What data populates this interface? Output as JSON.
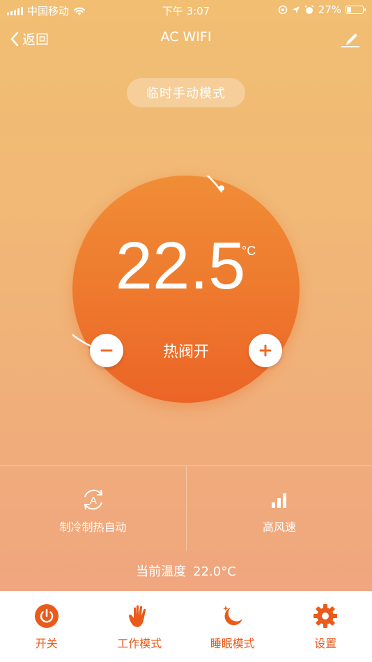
{
  "status_bar": {
    "carrier": "中国移动",
    "time": "下午 3:07",
    "battery_text": "27%",
    "battery_level": 0.27
  },
  "nav": {
    "back_label": "返回",
    "title": "AC WIFI"
  },
  "mode_pill": "临时手动模式",
  "thermostat": {
    "temperature": "22.5",
    "unit": "°C",
    "valve_status": "热阀开"
  },
  "info": {
    "mode_label": "制冷制热自动",
    "fan_label": "高风速"
  },
  "current_temp": {
    "label": "当前温度",
    "value": "22.0°C"
  },
  "tabs": [
    {
      "label": "开关",
      "icon": "power-icon"
    },
    {
      "label": "工作模式",
      "icon": "hand-icon"
    },
    {
      "label": "睡眠模式",
      "icon": "moon-icon"
    },
    {
      "label": "设置",
      "icon": "gear-icon"
    }
  ],
  "colors": {
    "accent": "#ea5a1a",
    "dial_top": "#f08d37",
    "dial_bottom": "#ec6426",
    "background_top": "#f1be72",
    "background_bottom": "#f0a27f"
  }
}
